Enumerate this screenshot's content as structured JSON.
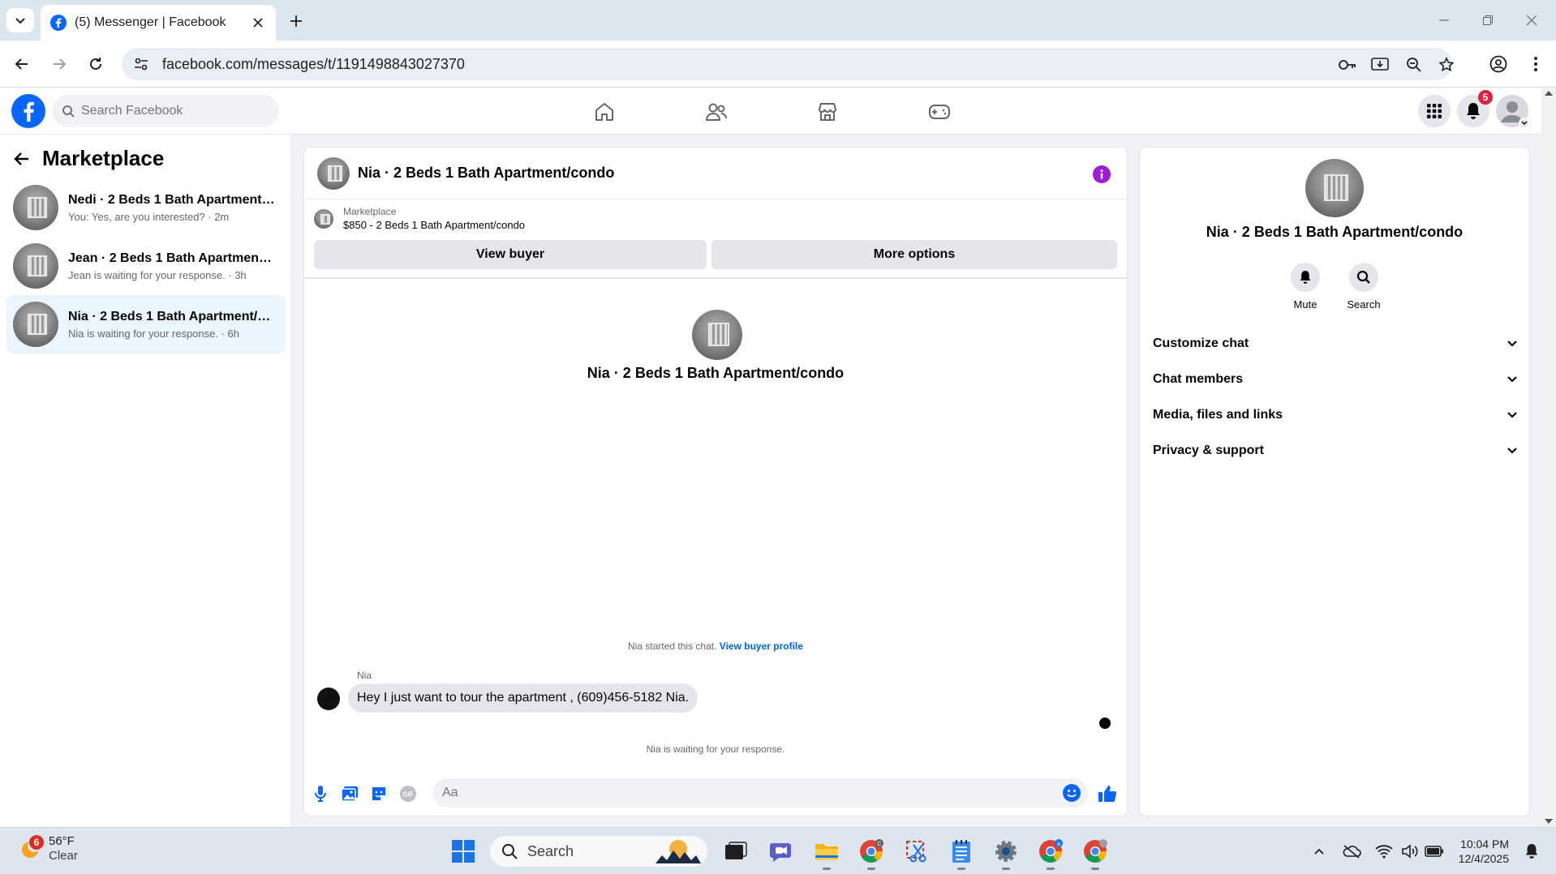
{
  "browser": {
    "tab_title": "(5) Messenger | Facebook",
    "url": "facebook.com/messages/t/1191498843027370"
  },
  "fb": {
    "search_placeholder": "Search Facebook",
    "notification_count": "5",
    "brand_color": "#0866ff"
  },
  "left": {
    "title": "Marketplace",
    "conversations": [
      {
        "name": "Nedi · 2 Beds 1 Bath Apartment/co...",
        "sub": "You: Yes, are you interested? · 2m"
      },
      {
        "name": "Jean · 2 Beds 1 Bath Apartment/co...",
        "sub": "Jean is waiting for your response. · 3h"
      },
      {
        "name": "Nia · 2 Beds 1 Bath Apartment/con...",
        "sub": "Nia is waiting for your response. · 6h"
      }
    ]
  },
  "chat": {
    "title": "Nia · 2 Beds 1 Bath Apartment/condo",
    "marketplace_label": "Marketplace",
    "listing": "$850 - 2 Beds 1 Bath Apartment/condo",
    "view_buyer": "View buyer",
    "more_options": "More options",
    "center_name": "Nia · 2 Beds 1 Bath Apartment/condo",
    "started_note": "Nia started this chat.",
    "view_buyer_profile": "View buyer profile",
    "sender": "Nia",
    "message": "Hey I just want to tour the apartment , (609)456-5182 Nia.",
    "waiting_note": "Nia is waiting for your response.",
    "composer_placeholder": "Aa"
  },
  "right": {
    "name": "Nia · 2 Beds 1 Bath Apartment/condo",
    "mute": "Mute",
    "search": "Search",
    "sections": [
      "Customize chat",
      "Chat members",
      "Media, files and links",
      "Privacy & support"
    ]
  },
  "taskbar": {
    "weather_badge": "6",
    "temp": "56°F",
    "condition": "Clear",
    "search": "Search",
    "time": "10:04 PM",
    "date": "12/4/2025"
  }
}
